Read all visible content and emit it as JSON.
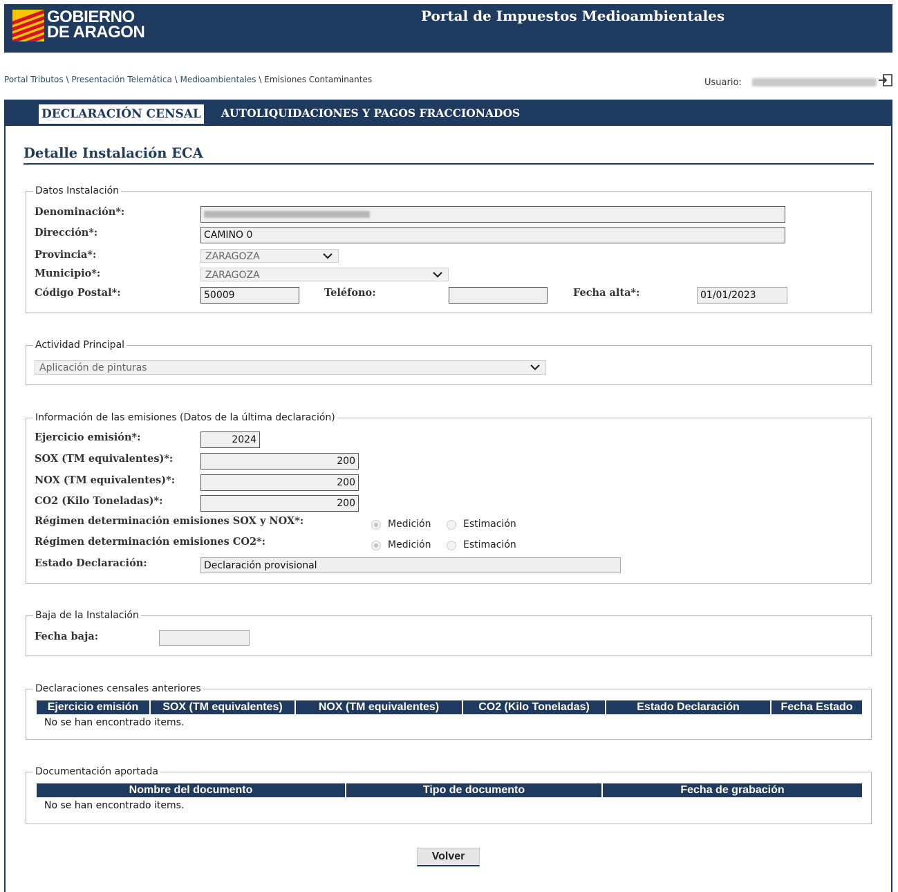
{
  "header": {
    "logo_line1": "GOBIERNO",
    "logo_line2": "DE ARAGON",
    "title": "Portal de Impuestos Medioambientales"
  },
  "breadcrumb": {
    "items": [
      "Portal Tributos",
      "Presentación Telemática",
      "Medioambientales",
      "Emisiones Contaminantes"
    ],
    "separator": " \\ "
  },
  "user": {
    "label": "Usuario:"
  },
  "tabs": [
    {
      "label": "DECLARACIÓN CENSAL",
      "active": true
    },
    {
      "label": "AUTOLIQUIDACIONES Y PAGOS FRACCIONADOS",
      "active": false
    }
  ],
  "page_title": "Detalle Instalación ECA",
  "datos_instalacion": {
    "legend": "Datos Instalación",
    "denominacion_label": "Denominación*:",
    "direccion_label": "Dirección*:",
    "direccion_value": "CAMINO 0",
    "provincia_label": "Provincia*:",
    "provincia_value": "ZARAGOZA",
    "municipio_label": "Municipio*:",
    "municipio_value": "ZARAGOZA",
    "cp_label": "Código Postal*:",
    "cp_value": "50009",
    "telefono_label": "Teléfono:",
    "telefono_value": "",
    "fecha_alta_label": "Fecha alta*:",
    "fecha_alta_value": "01/01/2023"
  },
  "actividad": {
    "legend": "Actividad Principal",
    "value": "Aplicación de pinturas"
  },
  "emisiones": {
    "legend": "Información de las emisiones  (Datos de la última declaración)",
    "ejercicio_label": "Ejercicio emisión*:",
    "ejercicio_value": "2024",
    "sox_label": "SOX (TM equivalentes)*:",
    "sox_value": "200",
    "nox_label": "NOX (TM equivalentes)*:",
    "nox_value": "200",
    "co2_label": "CO2 (Kilo Toneladas)*:",
    "co2_value": "200",
    "regimen_soxnox_label": "Régimen determinación emisiones SOX y NOX*:",
    "regimen_co2_label": "Régimen determinación emisiones CO2*:",
    "opt_medicion": "Medición",
    "opt_estimacion": "Estimación",
    "selected": "Medición",
    "estado_label": "Estado Declaración:",
    "estado_value": "Declaración provisional"
  },
  "baja": {
    "legend": "Baja de la Instalación",
    "fecha_label": "Fecha baja:",
    "fecha_value": ""
  },
  "declaraciones": {
    "legend": "Declaraciones censales anteriores",
    "columns": [
      "Ejercicio emisión",
      "SOX (TM equivalentes)",
      "NOX (TM equivalentes)",
      "CO2 (Kilo Toneladas)",
      "Estado Declaración",
      "Fecha Estado"
    ],
    "empty": "No se han encontrado items."
  },
  "documentacion": {
    "legend": "Documentación aportada",
    "columns": [
      "Nombre del documento",
      "Tipo de documento",
      "Fecha de grabación"
    ],
    "empty": "No se han encontrado items."
  },
  "actions": {
    "volver": "Volver"
  },
  "colors": {
    "navy": "#1f3a5f",
    "brand_yellow": "#f7c500",
    "brand_red": "#d4161c"
  }
}
